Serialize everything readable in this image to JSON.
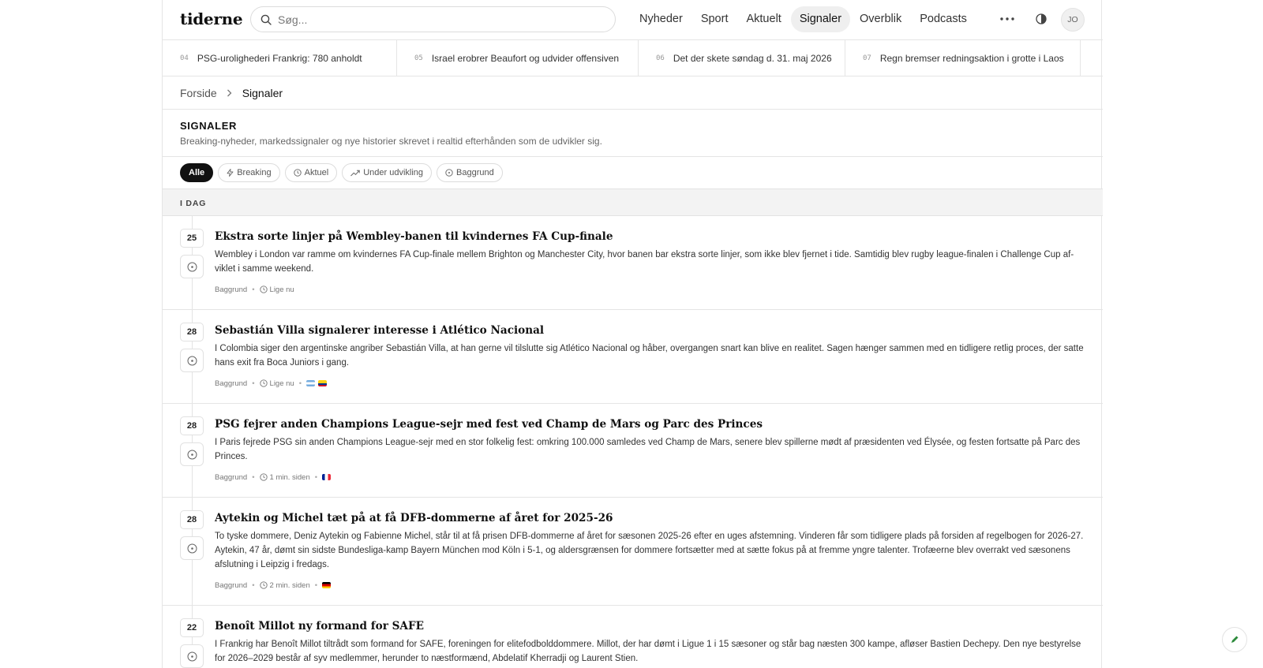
{
  "header": {
    "logo": "tiderne",
    "search_placeholder": "Søg...",
    "nav": [
      "Nyheder",
      "Sport",
      "Aktuelt",
      "Signaler",
      "Overblik",
      "Podcasts"
    ],
    "nav_active_index": 3,
    "avatar": "JO",
    "more_icon": "more-horizontal-icon",
    "theme_icon": "theme-toggle-icon"
  },
  "ticker": [
    {
      "num": "04",
      "text": "PSG-urolighederi Frankrig: 780 anholdt"
    },
    {
      "num": "05",
      "text": "Israel erobrer Beaufort og udvider offensiven"
    },
    {
      "num": "06",
      "text": "Det der skete søndag d. 31. maj 2026"
    },
    {
      "num": "07",
      "text": "Regn bremser redningsaktion i grotte i Laos"
    }
  ],
  "breadcrumb": {
    "home": "Forside",
    "current": "Signaler"
  },
  "section": {
    "title": "SIGNALER",
    "description": "Breaking-nyheder, markedssignaler og nye historier skrevet i realtid efterhånden som de udvikler sig."
  },
  "filters": [
    "Alle",
    "Breaking",
    "Aktuel",
    "Under udvikling",
    "Baggrund"
  ],
  "day_label": "I DAG",
  "articles": [
    {
      "num": "25",
      "title": "Ekstra sorte linjer på Wembley-banen til kvindernes FA Cup-finale",
      "text": "Wembley i London var ramme om kvindernes FA Cup-finale mellem Brighton og Manchester City, hvor banen bar ekstra sorte linjer, som ikke blev fjernet i tide. Samtidig blev rugby league-finalen i Challenge Cup af­viklet i samme weekend.",
      "category": "Baggrund",
      "time": "Lige nu"
    },
    {
      "num": "28",
      "title": "Sebastián Villa signalerer interesse i Atlético Nacional",
      "text": "I Colombia siger den argentinske angriber Sebastián Villa, at han gerne vil tilslutte sig Atlético Nacional og håber, overgangen snart kan blive en realitet. Sagen hænger sammen med en tidligere retlig proces, der satte hans exit fra Boca Juniors i gang.",
      "category": "Baggrund",
      "time": "Lige nu"
    },
    {
      "num": "28",
      "title": "PSG fejrer anden Champions League-sejr med fest ved Champ de Mars og Parc des Princes",
      "text": "I Paris fejrede PSG sin anden Champions League-sejr med en stor folkelig fest: omkring 100.000 samledes ved Champ de Mars, senere blev spillerne mødt af præsidenten ved Élysée, og festen fortsatte på Parc des Princes.",
      "category": "Baggrund",
      "time": "1 min. siden"
    },
    {
      "num": "28",
      "title": "Aytekin og Michel tæt på at få DFB-dommerne af året for 2025-26",
      "text": "To tyske dommere, Deniz Aytekin og Fabienne Michel, står til at få prisen DFB-dommerne af året for sæsonen 2025-26 efter en uges afstemning. Vinderen får som tidligere plads på forsiden af regelbogen for 2026-27. Aytekin, 47 år, dømt sin sidste Bundesliga-kamp Bayern München mod Köln i 5-1, og aldersgrænsen for dommere fortsætter med at sætte fokus på at fremme yngre talenter. Trofæerne blev overrakt ved sæso­nens afslutning i Leipzig i fredags.",
      "category": "Baggrund",
      "time": "2 min. siden"
    },
    {
      "num": "22",
      "title": "Benoît Millot ny formand for SAFE",
      "text": "I Frankrig har Benoît Millot tiltrådt som formand for SAFE, foreningen for elitefodbolddommere. Millot, der har dømt i Ligue 1 i 15 sæsoner og står bag næsten 300 kampe, afløser Bastien Dechepy. Den nye besty­relse for 2026–2029 består af syv medlemmer, herunder to næstformænd, Abdelatif Kherradji og Laurent Stien.",
      "category": "",
      "time": ""
    }
  ],
  "flag_icons": {
    "article_2": [
      "flag-argentina-icon",
      "flag-colombia-icon"
    ],
    "article_3": [
      "flag-france-icon"
    ],
    "article_4": [
      "flag-germany-icon"
    ]
  },
  "colors": {
    "accent": "#111111",
    "border": "#e5e5e5",
    "day_band": "#f3f3f3"
  }
}
